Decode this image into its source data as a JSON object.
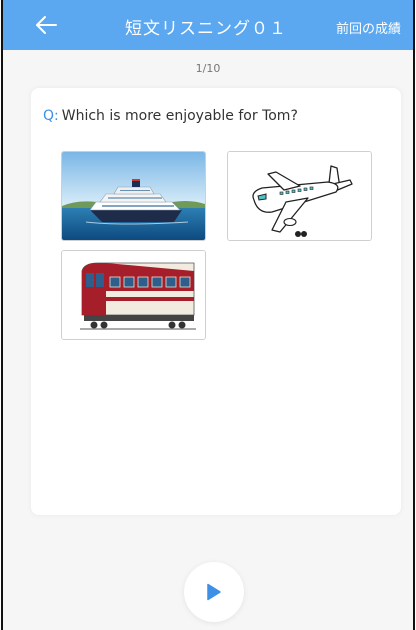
{
  "header": {
    "title": "短文リスニング０１",
    "history_label": "前回の成績",
    "accent_color": "#5ba8f1",
    "back_icon": "arrow-left-icon"
  },
  "progress": {
    "text": "1/10",
    "current": 1,
    "total": 10
  },
  "question": {
    "label": "Q:",
    "text": "Which is more enjoyable for Tom?"
  },
  "options": [
    {
      "id": "ship",
      "image": "cruise-ship-image"
    },
    {
      "id": "airplane",
      "image": "airplane-image"
    },
    {
      "id": "train",
      "image": "train-image"
    }
  ],
  "player": {
    "icon": "play-icon",
    "icon_color": "#3e8fe6"
  }
}
